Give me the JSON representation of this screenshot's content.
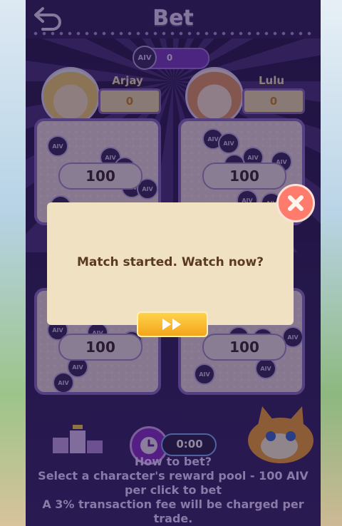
{
  "header": {
    "title": "Bet"
  },
  "balance": {
    "value": "0",
    "coin_label": "AIV"
  },
  "players": [
    {
      "name": "Arjay",
      "score": "0",
      "pool_amount": "100"
    },
    {
      "name": "Lulu",
      "score": "0",
      "pool_amount": "100"
    },
    {
      "pool_amount": "100"
    },
    {
      "pool_amount": "100"
    }
  ],
  "coin_label": "AIV",
  "modal": {
    "message": "Match started. Watch now?",
    "action_icon": "fast-forward-icon",
    "close_icon": "close-icon"
  },
  "timer": {
    "value": "0:00"
  },
  "howto": {
    "title": "How to bet?",
    "line1": "Select a character's reward pool - 100 AIV",
    "line2": "per click to bet",
    "line3": "A 3% transaction fee will be charged per",
    "line4": "trade."
  },
  "colors": {
    "accent": "#8d2fd2",
    "modal_bg": "#f1e1c3",
    "button": "#f3a51c",
    "close": "#ff7b6b"
  }
}
